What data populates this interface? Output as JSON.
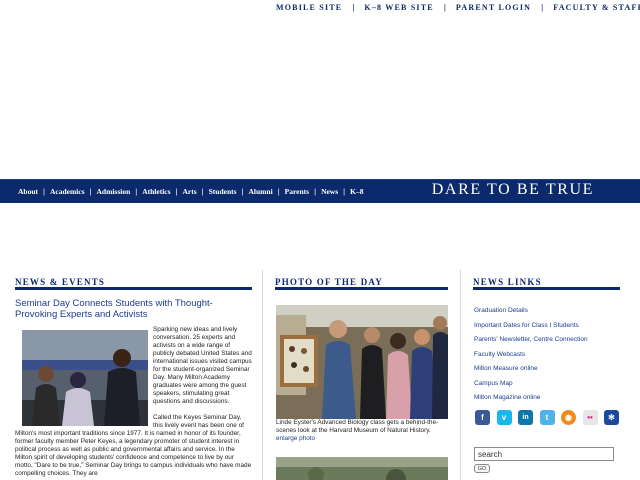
{
  "top_links": [
    "MOBILE SITE",
    "K–8 WEB SITE",
    "PARENT LOGIN",
    "FACULTY & STAFF"
  ],
  "nav": {
    "items": [
      "About",
      "Academics",
      "Admission",
      "Athletics",
      "Arts",
      "Students",
      "Alumni",
      "Parents",
      "News",
      "K–8"
    ],
    "tagline": "DARE TO BE TRUE"
  },
  "columns": {
    "news_events": "NEWS & EVENTS",
    "photo_of_day": "PHOTO OF THE DAY",
    "news_links": "NEWS LINKS"
  },
  "news": {
    "headline": "Seminar Day Connects Students with Thought-Provoking Experts and Activists",
    "para1": "Sparking new ideas and lively conversation, 25 experts and activists on a wide range of publicly debated United States and international issues visited campus for the student-organized Seminar Day. Many Milton Academy graduates were among the guest speakers, stimulating great questions and discussions.",
    "para2": "Called the Keyes Seminar Day, this lively event has been one of Milton's most important traditions since 1977. It is named in honor of its founder, former faculty member Peter Keyes, a legendary promoter of student interest in political process as well as public and governmental affairs and service. In the Milton spirit of developing students' confidence and competence to live by our motto, \"Dare to be true,\" Seminar Day brings to campus individuals who have made compelling choices. They are"
  },
  "photo_of_day": {
    "caption": "Linde Eyster's Advanced Biology class gets a behind-the-scenes look at the Harvard Museum of Natural History.",
    "enlarge": "enlarge photo"
  },
  "news_links": [
    {
      "text": "Graduation Details",
      "italic": false
    },
    {
      "text": "Important Dates for Class I Students",
      "italic": false
    },
    {
      "text": "Parents' Newsletter, Centre Connection",
      "italic": false
    },
    {
      "text": "Faculty Webcasts",
      "italic": false
    },
    {
      "text": "Milton Measure online",
      "italic": false
    },
    {
      "text": "Campus Map",
      "italic": false
    },
    {
      "text": "Milton Magazine online",
      "italic": false
    }
  ],
  "social_icons": [
    {
      "name": "facebook-icon",
      "glyph": "f",
      "color": "#3b5998"
    },
    {
      "name": "vimeo-icon",
      "glyph": "v",
      "color": "#1ab7ea"
    },
    {
      "name": "linkedin-icon",
      "glyph": "in",
      "color": "#0e76a8"
    },
    {
      "name": "twitter-icon",
      "glyph": "t",
      "color": "#4fb3e8"
    },
    {
      "name": "rss-icon",
      "glyph": "◉",
      "color": "#f08a1c"
    },
    {
      "name": "flickr-icon",
      "glyph": "••",
      "color": "#e6e6e6"
    },
    {
      "name": "snowflake-icon",
      "glyph": "✻",
      "color": "#1a4a9c"
    }
  ],
  "search": {
    "value": "search",
    "go": "GO"
  },
  "colors": {
    "brand": "#0b2a6b",
    "link": "#1a3d8c"
  }
}
